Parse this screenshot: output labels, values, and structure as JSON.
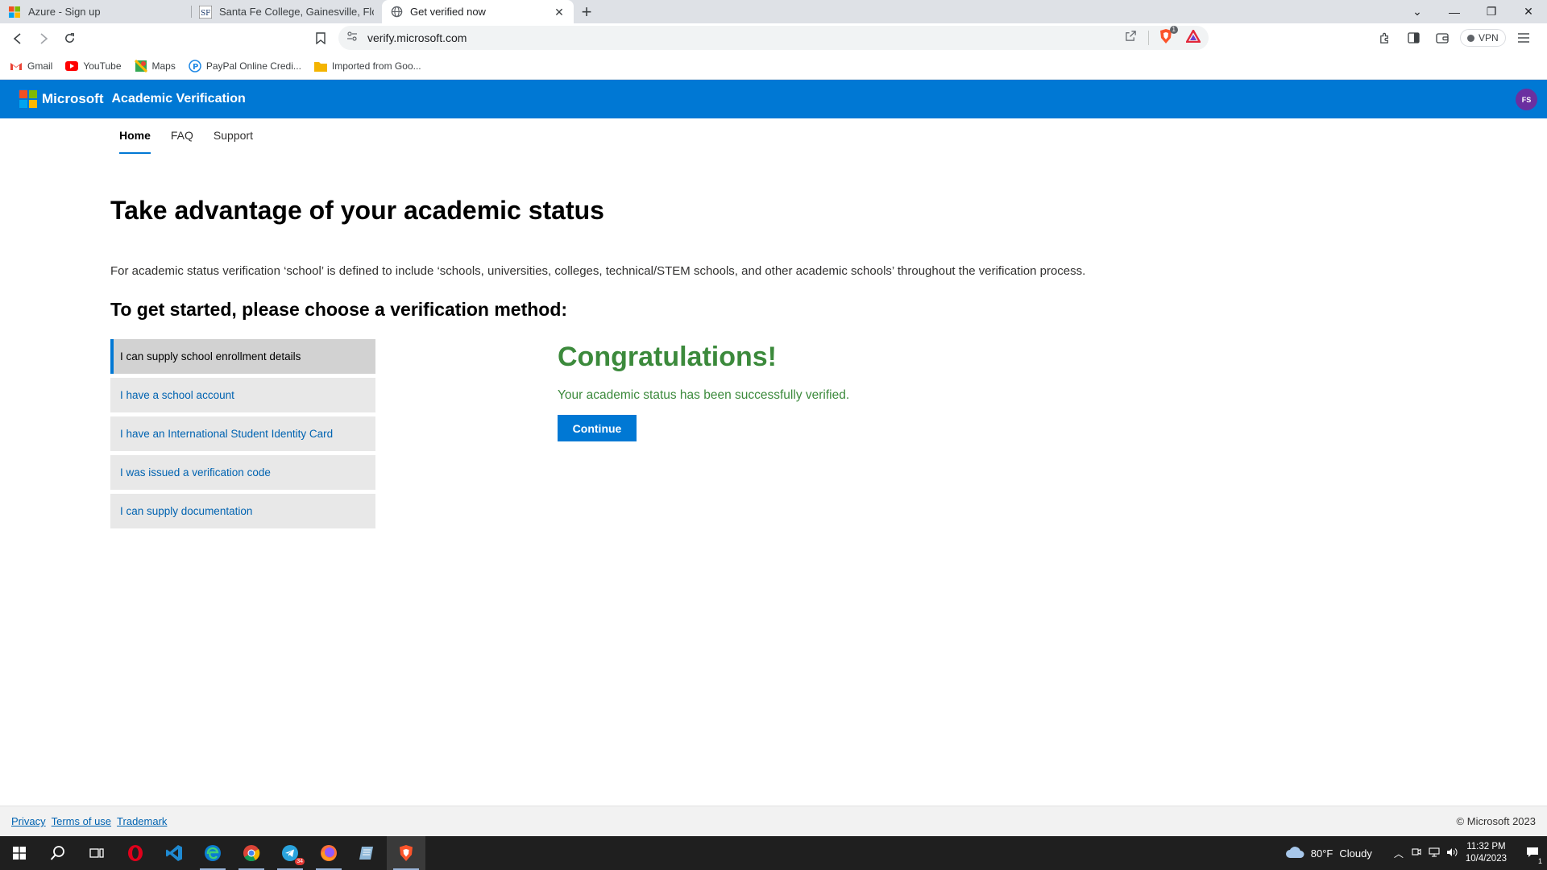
{
  "browser": {
    "tabs": [
      {
        "title": "Azure - Sign up",
        "active": false
      },
      {
        "title": "Santa Fe College, Gainesville, Florida -",
        "active": false
      },
      {
        "title": "Get verified now",
        "active": true
      }
    ],
    "url": "verify.microsoft.com",
    "vpn_label": "VPN",
    "shield_count": "1",
    "bookmarks": [
      {
        "label": "Gmail",
        "icon": "gmail-icon"
      },
      {
        "label": "YouTube",
        "icon": "youtube-icon"
      },
      {
        "label": "Maps",
        "icon": "maps-icon"
      },
      {
        "label": "PayPal Online Credi...",
        "icon": "paypal-icon"
      },
      {
        "label": "Imported from Goo...",
        "icon": "folder-icon"
      }
    ]
  },
  "header": {
    "brand": "Microsoft",
    "app_name": "Academic Verification",
    "avatar_initials": "FS",
    "accent_color": "#0078d4"
  },
  "nav": {
    "items": [
      "Home",
      "FAQ",
      "Support"
    ],
    "active": "Home"
  },
  "main": {
    "title": "Take advantage of your academic status",
    "description": "For academic status verification ‘school’ is defined to include ‘schools, universities, colleges, technical/STEM schools, and other academic schools’ throughout the verification process.",
    "choose_heading": "To get started, please choose a verification method:",
    "methods": [
      {
        "label": "I can supply school enrollment details",
        "selected": true
      },
      {
        "label": "I have a school account",
        "selected": false
      },
      {
        "label": "I have an International Student Identity Card",
        "selected": false
      },
      {
        "label": "I was issued a verification code",
        "selected": false
      },
      {
        "label": "I can supply documentation",
        "selected": false
      }
    ],
    "result_title": "Congratulations!",
    "result_message": "Your academic status has been successfully verified.",
    "continue_label": "Continue",
    "success_color": "#3c8a3c"
  },
  "footer": {
    "links": [
      "Privacy",
      "Terms of use",
      "Trademark"
    ],
    "copyright": "© Microsoft 2023"
  },
  "taskbar": {
    "apps": [
      "start-icon",
      "search-icon",
      "task-view-icon",
      "opera-icon",
      "vscode-icon",
      "edge-icon",
      "chrome-icon",
      "telegram-icon",
      "firefox-icon",
      "notes-icon",
      "brave-icon"
    ],
    "telegram_badge": "34",
    "weather_temp": "80°F",
    "weather_text": "Cloudy",
    "time": "11:32 PM",
    "date": "10/4/2023",
    "notification_count": "1"
  }
}
